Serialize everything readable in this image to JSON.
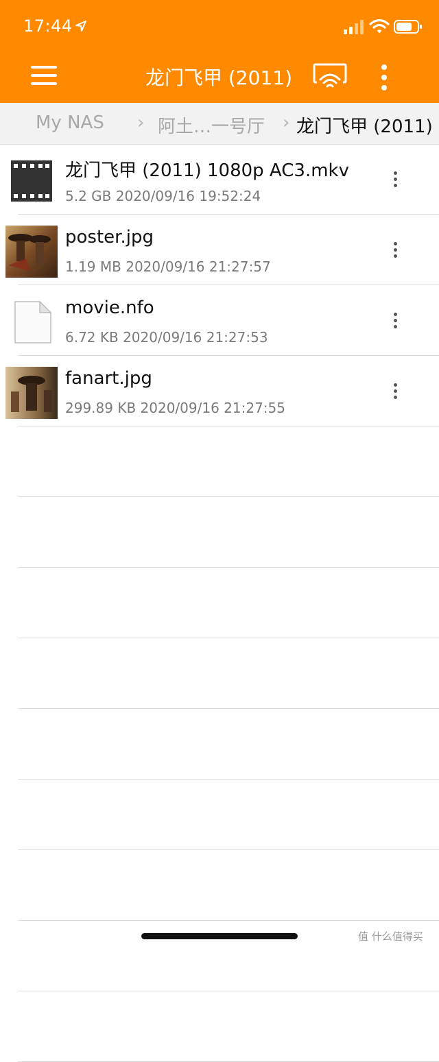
{
  "status_bar": {
    "time": "17:44"
  },
  "header": {
    "title": "龙门飞甲 (2011)"
  },
  "breadcrumb": {
    "root": "My NAS",
    "separator": "›",
    "middle": "阿土…一号厅",
    "current": "龙门飞甲 (2011)"
  },
  "files": [
    {
      "name": "龙门飞甲 (2011) 1080p AC3.mkv",
      "meta": "5.2 GB 2020/09/16 19:52:24",
      "icon": "video-file-icon"
    },
    {
      "name": "poster.jpg",
      "meta": "1.19 MB 2020/09/16 21:27:57",
      "icon": "image-thumbnail"
    },
    {
      "name": "movie.nfo",
      "meta": "6.72 KB 2020/09/16 21:27:53",
      "icon": "document-file-icon"
    },
    {
      "name": "fanart.jpg",
      "meta": "299.89 KB 2020/09/16 21:27:55",
      "icon": "image-thumbnail"
    }
  ],
  "watermark": "值 什么值得买",
  "colors": {
    "accent": "#ff8a00",
    "breadcrumb_bg": "#f2f2f2"
  }
}
